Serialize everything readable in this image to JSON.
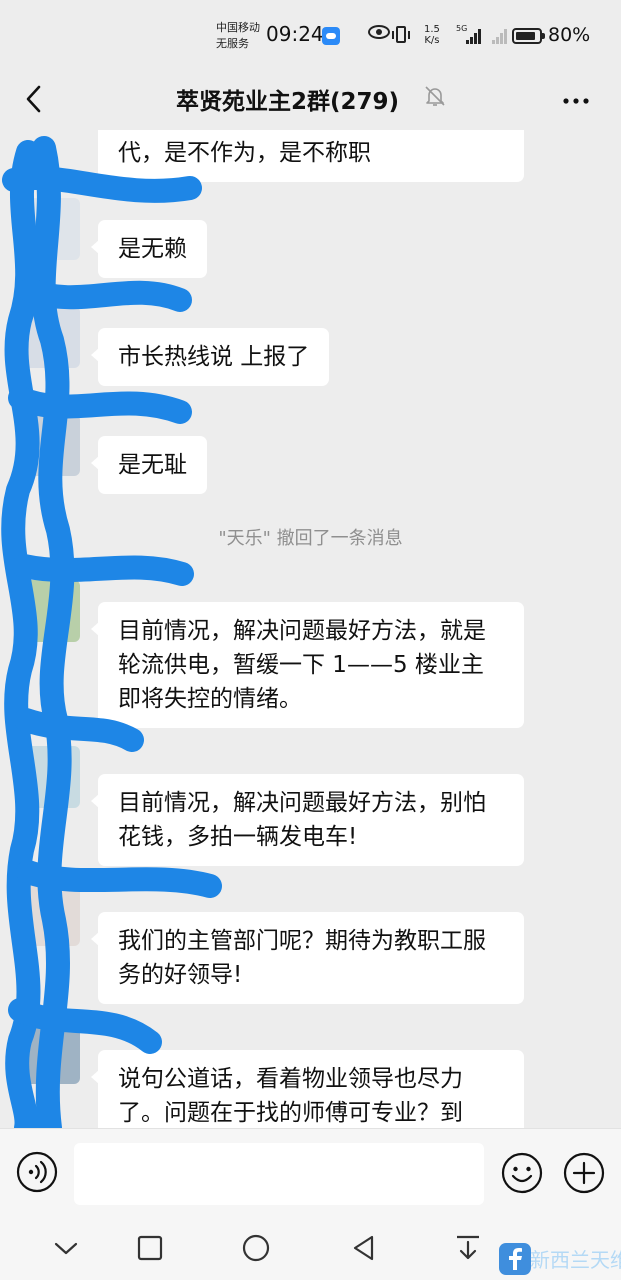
{
  "status_bar": {
    "carrier_line1": "中国移动",
    "carrier_line2": "无服务",
    "time": "09:24",
    "net_speed_value": "1.5",
    "net_speed_unit": "K/s",
    "signal_tag": "5G",
    "battery": "80%",
    "battery_level": 0.8
  },
  "nav": {
    "title": "萃贤苑业主2群(279)",
    "back_icon": "chevron-left-icon",
    "mute_icon": "bell-off-icon",
    "more_icon": "more-dots-icon"
  },
  "messages": [
    {
      "text": "代，是不作为，是不称职"
    },
    {
      "text": "是无赖"
    },
    {
      "text": "市长热线说 上报了"
    },
    {
      "text": "是无耻"
    },
    {
      "system": "\"天乐\" 撤回了一条消息"
    },
    {
      "text": "目前情况，解决问题最好方法，就是轮流供电，暂缓一下 1——5 楼业主即将失控的情绪。"
    },
    {
      "text": "目前情况，解决问题最好方法，别怕花钱，多拍一辆发电车!"
    },
    {
      "text": "我们的主管部门呢？期待为教职工服务的好领导!"
    },
    {
      "text": "说句公道话，看着物业领导也尽力了。问题在于找的师傅可专业？到"
    }
  ],
  "input": {
    "value": "",
    "voice_icon": "voice-icon",
    "emoji_icon": "emoji-icon",
    "plus_icon": "plus-icon"
  },
  "system_nav": {
    "icons": [
      "chevron-down-icon",
      "square-icon",
      "circle-icon",
      "triangle-back-icon",
      "download-icon"
    ]
  },
  "watermark": {
    "text": "新西兰天维网",
    "icon": "facebook-icon"
  },
  "colors": {
    "background": "#ededed",
    "bubble": "#ffffff",
    "scribble": "#1e86e6",
    "system_text": "#8f8f8f"
  }
}
